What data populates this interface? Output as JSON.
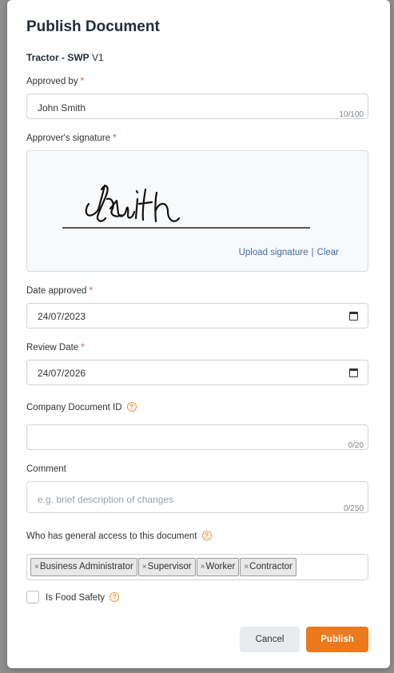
{
  "modal": {
    "title": "Publish Document",
    "document_name": "Tractor - SWP",
    "document_version": "V1"
  },
  "approved_by": {
    "label": "Approved by",
    "required_mark": "*",
    "value": "John Smith",
    "counter": "10/100"
  },
  "signature": {
    "label": "Approver's signature",
    "required_mark": "*",
    "upload_label": "Upload signature",
    "separator": "|",
    "clear_label": "Clear"
  },
  "date_approved": {
    "label": "Date approved",
    "required_mark": "*",
    "value": "24/07/2023"
  },
  "review_date": {
    "label": "Review Date",
    "required_mark": "*",
    "value": "24/07/2026"
  },
  "company_doc_id": {
    "label": "Company Document ID",
    "value": "",
    "counter": "0/20"
  },
  "comment": {
    "label": "Comment",
    "placeholder": "e.g. brief description of changes",
    "counter": "0/250"
  },
  "access": {
    "label": "Who has general access to this document",
    "remove_glyph": "×",
    "tags": [
      "Business Administrator",
      "Supervisor",
      "Worker",
      "Contractor"
    ]
  },
  "food_safety": {
    "label": "Is Food Safety",
    "checked": false
  },
  "actions": {
    "cancel_label": "Cancel",
    "publish_label": "Publish"
  },
  "colors": {
    "accent": "#ec7a1c",
    "help_icon": "#f0963f",
    "link": "#3a6ea5",
    "required": "#e04b3b"
  },
  "icons": {
    "help": "help-circle-icon",
    "calendar": "calendar-icon"
  }
}
